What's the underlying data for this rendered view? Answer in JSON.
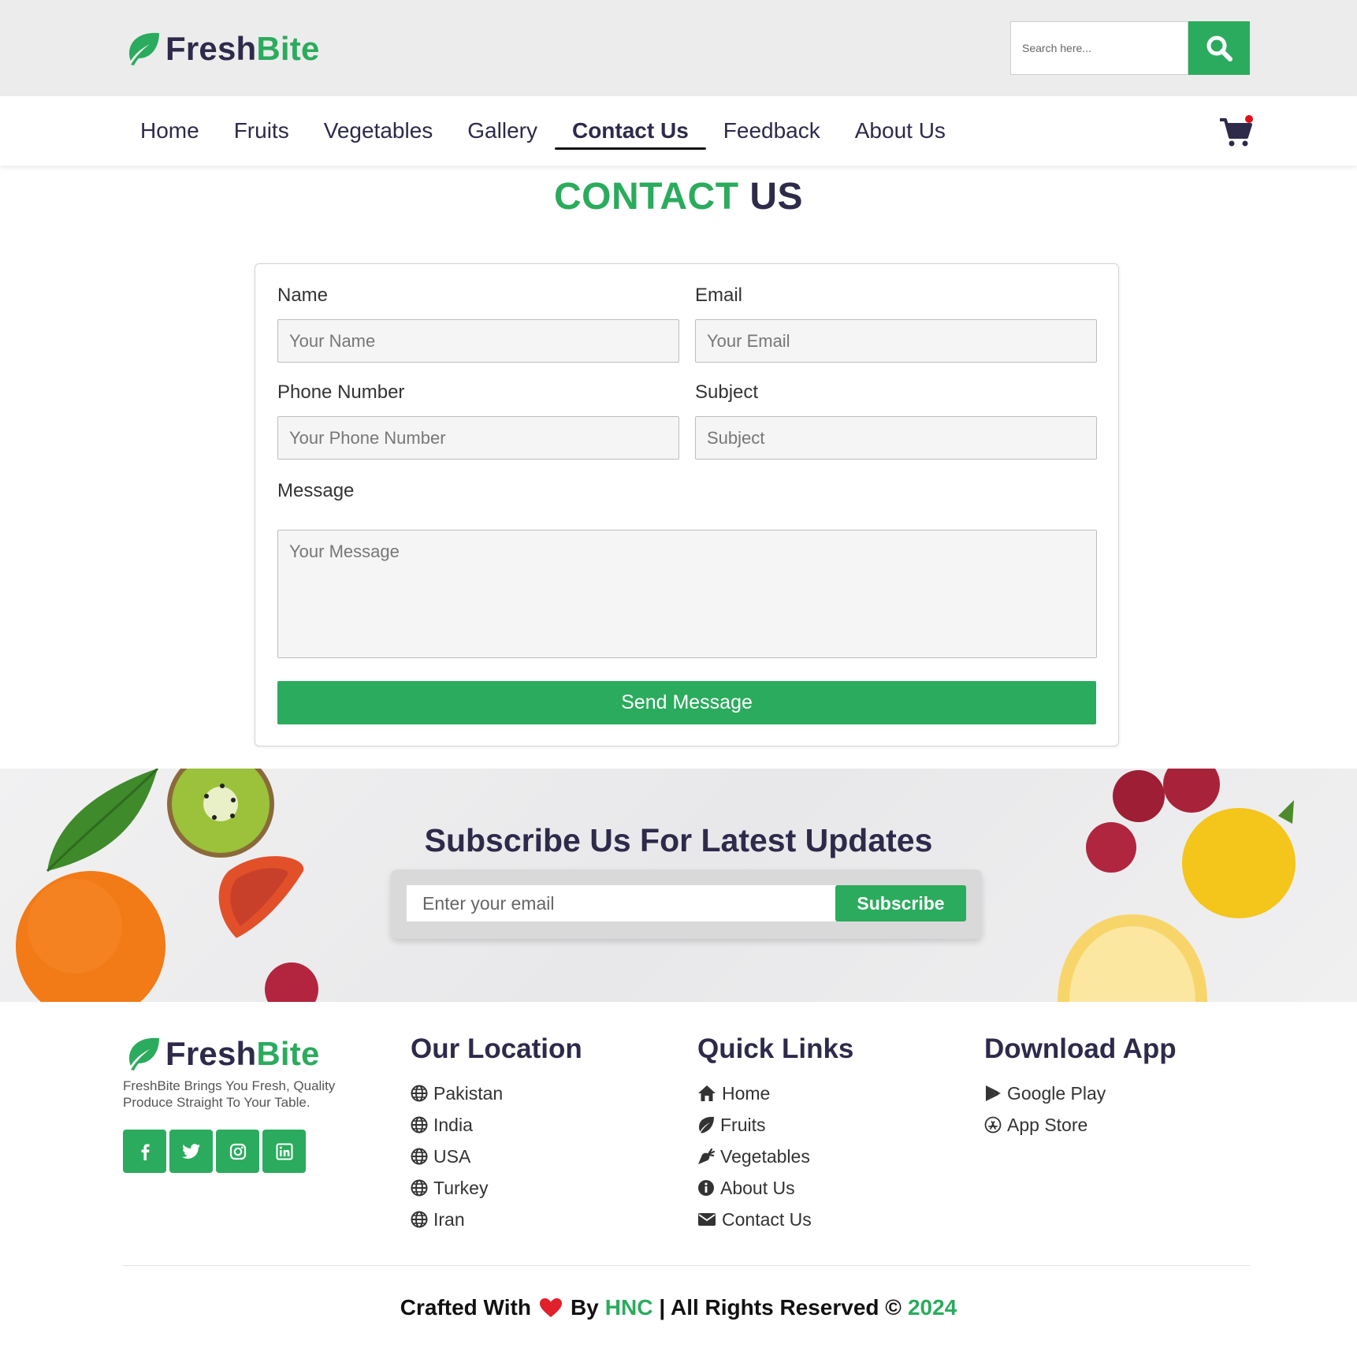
{
  "brand": {
    "name_part1": "Fresh",
    "name_part2": "Bite",
    "accent_color": "#2bab5d",
    "dark_color": "#2d2a4a"
  },
  "search": {
    "placeholder": "Search here..."
  },
  "nav": {
    "items": [
      {
        "label": "Home"
      },
      {
        "label": "Fruits"
      },
      {
        "label": "Vegetables"
      },
      {
        "label": "Gallery"
      },
      {
        "label": "Contact Us"
      },
      {
        "label": "Feedback"
      },
      {
        "label": "About Us"
      }
    ],
    "active": "Contact Us"
  },
  "contact": {
    "title_part1": "CONTACT",
    "title_part2": "US",
    "name_label": "Name",
    "name_placeholder": "Your Name",
    "email_label": "Email",
    "email_placeholder": "Your Email",
    "phone_label": "Phone Number",
    "phone_placeholder": "Your Phone Number",
    "subject_label": "Subject",
    "subject_placeholder": "Subject",
    "message_label": "Message",
    "message_placeholder": "Your Message",
    "send_label": "Send Message"
  },
  "subscribe": {
    "title": "Subscribe Us For Latest Updates",
    "email_placeholder": "Enter your email",
    "button_label": "Subscribe"
  },
  "footer": {
    "description": "FreshBite Brings You Fresh, Quality Produce Straight To Your Table.",
    "location": {
      "heading": "Our Location",
      "items": [
        "Pakistan",
        "India",
        "USA",
        "Turkey",
        "Iran"
      ]
    },
    "quick_links": {
      "heading": "Quick Links",
      "items": [
        "Home",
        "Fruits",
        "Vegetables",
        "About Us",
        "Contact Us"
      ]
    },
    "download": {
      "heading": "Download App",
      "items": [
        "Google Play",
        "App Store"
      ]
    },
    "copyright": {
      "crafted": "Crafted With",
      "by": "By",
      "author": "HNC",
      "rights": "| All Rights Reserved ©",
      "year": "2024"
    }
  }
}
